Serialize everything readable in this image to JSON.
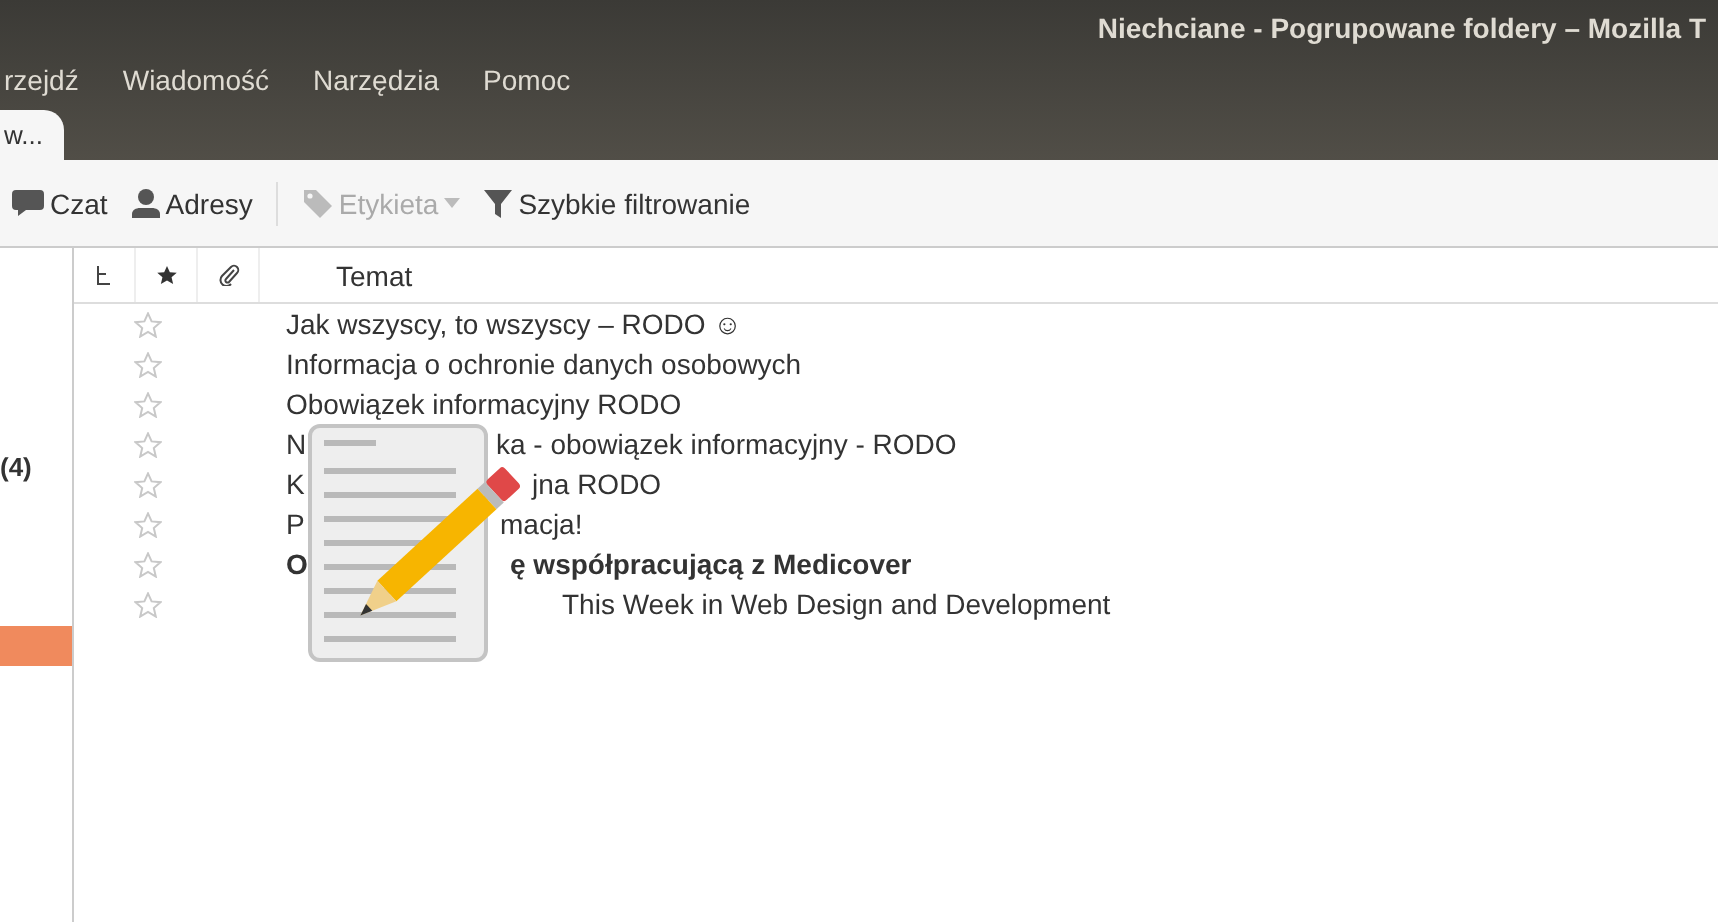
{
  "window": {
    "title": "Niechciane - Pogrupowane foldery – Mozilla T"
  },
  "menu": [
    "rzejdź",
    "Wiadomość",
    "Narzędzia",
    "Pomoc"
  ],
  "tabs": [
    {
      "label": "w...",
      "selected": true
    }
  ],
  "toolbar": [
    {
      "label": "Czat",
      "kind": "chat",
      "disabled": false
    },
    {
      "label": "Adresy",
      "kind": "contacts",
      "disabled": false
    },
    {
      "label": "Etykieta",
      "kind": "tag",
      "disabled": true
    },
    {
      "label": "Szybkie filtrowanie",
      "kind": "filter",
      "disabled": false
    }
  ],
  "folder_pane": {
    "items": [
      {
        "count": "(4)",
        "selected": false
      },
      {
        "selected": true
      }
    ]
  },
  "table": {
    "columns": [
      "Temat"
    ],
    "rows": [
      {
        "starred": false,
        "unread": false,
        "subject": "Jak wszyscy, to wszyscy – RODO ☺"
      },
      {
        "starred": false,
        "unread": false,
        "subject": "Informacja o ochronie danych osobowych"
      },
      {
        "starred": false,
        "unread": false,
        "subject": "Obowiązek informacyjny RODO"
      },
      {
        "starred": false,
        "unread": false,
        "subject": "N",
        "subject_after_overlay": "ka - obowiązek informacyjny - RODO"
      },
      {
        "starred": false,
        "unread": false,
        "subject": "K",
        "subject_after_overlay": "jna RODO"
      },
      {
        "starred": false,
        "unread": false,
        "subject": "P",
        "subject_after_overlay": "macja!"
      },
      {
        "starred": false,
        "unread": true,
        "subject": "O",
        "subject_after_overlay": "ę współpracującą z Medicover"
      },
      {
        "starred": false,
        "unread": false,
        "subject_after_overlay": "This Week in Web Design and Development"
      }
    ]
  }
}
